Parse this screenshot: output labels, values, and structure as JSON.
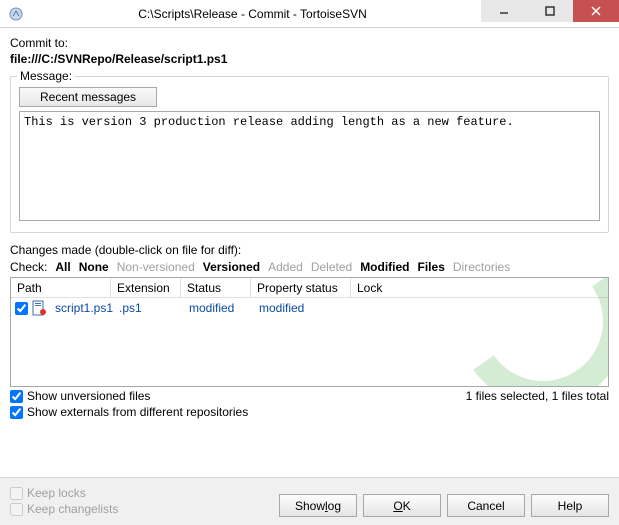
{
  "titlebar": {
    "title": "C:\\Scripts\\Release - Commit - TortoiseSVN"
  },
  "commit_to_label": "Commit to:",
  "repo_url": "file:///C:/SVNRepo/Release/script1.ps1",
  "message_group_label": "Message:",
  "recent_messages_btn": "Recent messages",
  "message_text": "This is version 3 production release adding length as a new feature.",
  "changes_label": "Changes made (double-click on file for diff):",
  "check_label": "Check:",
  "filters": {
    "all": "All",
    "none": "None",
    "nonversioned": "Non-versioned",
    "versioned": "Versioned",
    "added": "Added",
    "deleted": "Deleted",
    "modified": "Modified",
    "files": "Files",
    "directories": "Directories"
  },
  "columns": {
    "path": "Path",
    "extension": "Extension",
    "status": "Status",
    "property_status": "Property status",
    "lock": "Lock"
  },
  "files": [
    {
      "checked": true,
      "name": "script1.ps1",
      "extension": ".ps1",
      "status": "modified",
      "property_status": "modified",
      "lock": ""
    }
  ],
  "show_unversioned": {
    "label": "Show unversioned files",
    "checked": true
  },
  "show_externals": {
    "label": "Show externals from different repositories",
    "checked": true
  },
  "summary": "1 files selected, 1 files total",
  "keep_locks": {
    "label": "Keep locks",
    "checked": false
  },
  "keep_changelists": {
    "label": "Keep changelists",
    "checked": false
  },
  "buttons": {
    "show_log": "Show log",
    "ok": "OK",
    "cancel": "Cancel",
    "help": "Help"
  }
}
